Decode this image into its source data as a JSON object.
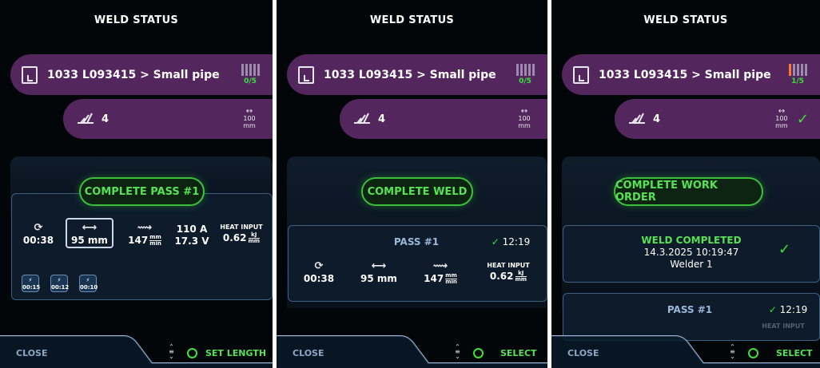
{
  "panels": [
    {
      "title": "WELD STATUS",
      "work_order": {
        "text": "1033 L093415 > Small pipe",
        "progress": "0/5",
        "completed_fraction": 0
      },
      "joint": {
        "number": "4",
        "length_value": "100",
        "length_unit": "mm"
      },
      "action_button": "COMPLETE PASS #1",
      "stats": {
        "time": "00:38",
        "length": "95 mm",
        "speed_value": "147",
        "speed_unit_top": "mm",
        "speed_unit_bottom": "min",
        "current": "110 A",
        "voltage": "17.3 V",
        "heat_label": "HEAT INPUT",
        "heat_value": "0.62",
        "heat_unit_top": "kJ",
        "heat_unit_bottom": "mm"
      },
      "tack_times": [
        "00:15",
        "00:12",
        "00:10"
      ],
      "footer": {
        "close": "CLOSE",
        "action": "SET LENGTH"
      }
    },
    {
      "title": "WELD STATUS",
      "work_order": {
        "text": "1033 L093415 > Small pipe",
        "progress": "0/5",
        "completed_fraction": 0
      },
      "joint": {
        "number": "4",
        "length_value": "100",
        "length_unit": "mm"
      },
      "action_button": "COMPLETE WELD",
      "pass": {
        "title": "PASS #1",
        "time": "12:19",
        "time_spent": "00:38",
        "length": "95 mm",
        "speed_value": "147",
        "speed_unit_top": "mm",
        "speed_unit_bottom": "min",
        "heat_label": "HEAT INPUT",
        "heat_value": "0.62",
        "heat_unit_top": "kJ",
        "heat_unit_bottom": "mm"
      },
      "footer": {
        "close": "CLOSE",
        "action": "SELECT"
      }
    },
    {
      "title": "WELD STATUS",
      "work_order": {
        "text": "1033 L093415 > Small pipe",
        "progress": "1/5",
        "completed_fraction": 0.2
      },
      "joint": {
        "number": "4",
        "length_value": "100",
        "length_unit": "mm"
      },
      "action_button": "COMPLETE WORK ORDER",
      "completed": {
        "title": "WELD COMPLETED",
        "datetime": "14.3.2025 10:19:47",
        "welder": "Welder 1"
      },
      "pass": {
        "title": "PASS #1",
        "time": "12:19",
        "partial_label": "HEAT INPUT"
      },
      "footer": {
        "close": "CLOSE",
        "action": "SELECT"
      }
    }
  ],
  "icons": {
    "work_order": "document-icon",
    "progress": "progress-bars-icon",
    "weld": "weld-symbol-icon",
    "length": "length-arrow-icon",
    "timer": "timer-icon",
    "speed": "travel-speed-icon",
    "check": "check-icon",
    "scroll": "scroll-wheel-icon",
    "confirm": "circle-button-icon"
  },
  "colors": {
    "accent_green": "#3fe03a",
    "purple": "#53275e",
    "card_border": "#3d5f83",
    "progress_done": "#ff7a2a"
  }
}
